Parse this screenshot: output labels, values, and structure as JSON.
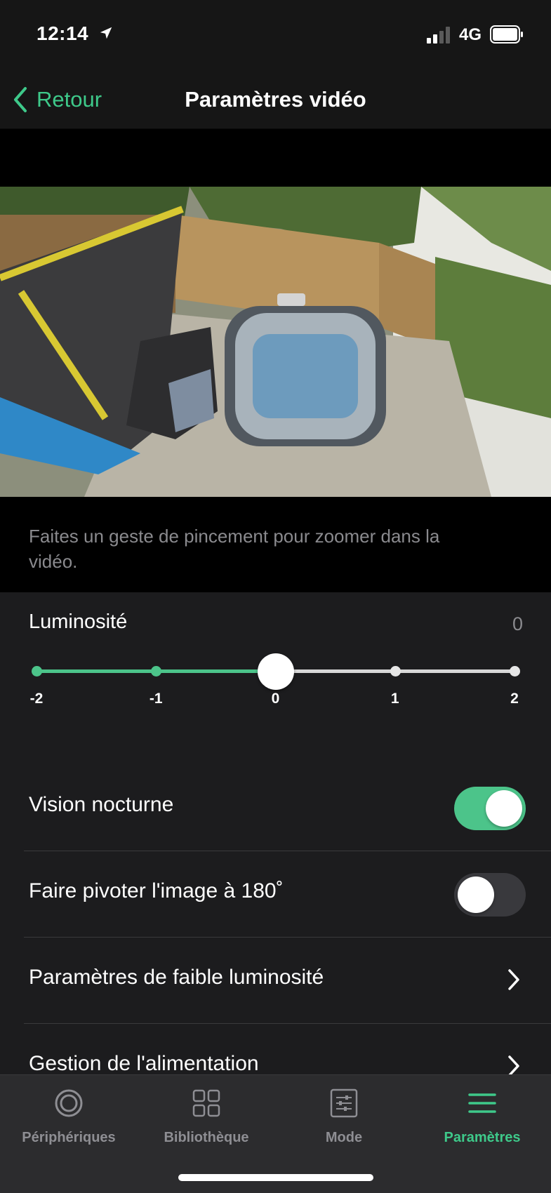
{
  "status_bar": {
    "time": "12:14",
    "network": "4G",
    "location_icon": "location-arrow-icon",
    "signal_icon": "signal-bars-icon",
    "battery_icon": "battery-icon"
  },
  "navbar": {
    "back_label": "Retour",
    "back_icon": "chevron-left-icon",
    "title": "Paramètres vidéo"
  },
  "video": {
    "description_icon": "camera-live-feed"
  },
  "hint": {
    "text": "Faites un geste de pincement pour zoomer dans la vidéo."
  },
  "luminosity": {
    "label": "Luminosité",
    "value": "0",
    "slider": {
      "min": -2,
      "max": 2,
      "current": 0,
      "ticks": [
        "-2",
        "-1",
        "0",
        "1",
        "2"
      ]
    }
  },
  "settings": {
    "night_vision": {
      "label": "Vision nocturne",
      "enabled": true
    },
    "rotate_image": {
      "label": "Faire pivoter l'image à 180˚",
      "enabled": false
    },
    "low_light": {
      "label": "Paramètres de faible luminosité"
    },
    "power_management": {
      "label": "Gestion de l'alimentation"
    }
  },
  "tabbar": {
    "tabs": [
      {
        "label": "Périphériques",
        "icon": "device-ring-icon",
        "active": false
      },
      {
        "label": "Bibliothèque",
        "icon": "grid-icon",
        "active": false
      },
      {
        "label": "Mode",
        "icon": "sliders-icon",
        "active": false
      },
      {
        "label": "Paramètres",
        "icon": "menu-lines-icon",
        "active": true
      }
    ]
  },
  "colors": {
    "accent": "#3ec98a",
    "toggle_on": "#4cc48a",
    "background": "#1c1c1e",
    "secondary_text": "#8a8a8e"
  }
}
